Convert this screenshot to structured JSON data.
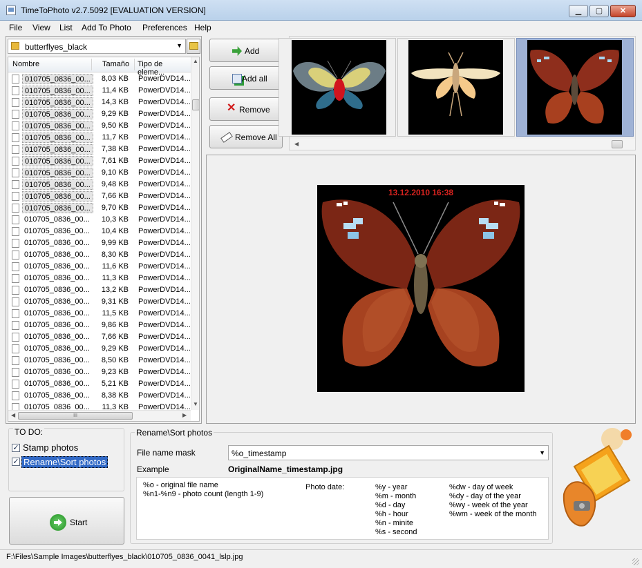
{
  "window": {
    "title": "TimeToPhoto v2.7.5092 [EVALUATION VERSION]",
    "min_label": "▁",
    "max_label": "▢",
    "close_label": "✕"
  },
  "menu": [
    "File",
    "View",
    "List",
    "Add To Photo",
    "Preferences",
    "Help"
  ],
  "folder": {
    "name": "butterflyes_black"
  },
  "file_list": {
    "columns": [
      "Nombre",
      "Tamaño",
      "Tipo de eleme..."
    ],
    "rows": [
      {
        "name": "010705_0836_00...",
        "size": "8,03 KB",
        "type": "PowerDVD14...",
        "selected": true
      },
      {
        "name": "010705_0836_00...",
        "size": "11,4 KB",
        "type": "PowerDVD14...",
        "selected": true
      },
      {
        "name": "010705_0836_00...",
        "size": "14,3 KB",
        "type": "PowerDVD14...",
        "selected": true
      },
      {
        "name": "010705_0836_00...",
        "size": "9,29 KB",
        "type": "PowerDVD14...",
        "selected": true
      },
      {
        "name": "010705_0836_00...",
        "size": "9,50 KB",
        "type": "PowerDVD14...",
        "selected": true
      },
      {
        "name": "010705_0836_00...",
        "size": "11,7 KB",
        "type": "PowerDVD14...",
        "selected": true
      },
      {
        "name": "010705_0836_00...",
        "size": "7,38 KB",
        "type": "PowerDVD14...",
        "selected": true
      },
      {
        "name": "010705_0836_00...",
        "size": "7,61 KB",
        "type": "PowerDVD14...",
        "selected": true
      },
      {
        "name": "010705_0836_00...",
        "size": "9,10 KB",
        "type": "PowerDVD14...",
        "selected": true
      },
      {
        "name": "010705_0836_00...",
        "size": "9,48 KB",
        "type": "PowerDVD14...",
        "selected": true
      },
      {
        "name": "010705_0836_00...",
        "size": "7,66 KB",
        "type": "PowerDVD14...",
        "selected": true
      },
      {
        "name": "010705_0836_00...",
        "size": "9,70 KB",
        "type": "PowerDVD14...",
        "selected": true
      },
      {
        "name": "010705_0836_00...",
        "size": "10,3 KB",
        "type": "PowerDVD14...",
        "selected": false
      },
      {
        "name": "010705_0836_00...",
        "size": "10,4 KB",
        "type": "PowerDVD14...",
        "selected": false
      },
      {
        "name": "010705_0836_00...",
        "size": "9,99 KB",
        "type": "PowerDVD14...",
        "selected": false
      },
      {
        "name": "010705_0836_00...",
        "size": "8,30 KB",
        "type": "PowerDVD14...",
        "selected": false
      },
      {
        "name": "010705_0836_00...",
        "size": "11,6 KB",
        "type": "PowerDVD14...",
        "selected": false
      },
      {
        "name": "010705_0836_00...",
        "size": "11,3 KB",
        "type": "PowerDVD14...",
        "selected": false
      },
      {
        "name": "010705_0836_00...",
        "size": "13,2 KB",
        "type": "PowerDVD14...",
        "selected": false
      },
      {
        "name": "010705_0836_00...",
        "size": "9,31 KB",
        "type": "PowerDVD14...",
        "selected": false
      },
      {
        "name": "010705_0836_00...",
        "size": "11,5 KB",
        "type": "PowerDVD14...",
        "selected": false
      },
      {
        "name": "010705_0836_00...",
        "size": "9,86 KB",
        "type": "PowerDVD14...",
        "selected": false
      },
      {
        "name": "010705_0836_00...",
        "size": "7,66 KB",
        "type": "PowerDVD14...",
        "selected": false
      },
      {
        "name": "010705_0836_00...",
        "size": "9,29 KB",
        "type": "PowerDVD14...",
        "selected": false
      },
      {
        "name": "010705_0836_00...",
        "size": "8,50 KB",
        "type": "PowerDVD14...",
        "selected": false
      },
      {
        "name": "010705_0836_00...",
        "size": "9,23 KB",
        "type": "PowerDVD14...",
        "selected": false
      },
      {
        "name": "010705_0836_00...",
        "size": "5,21 KB",
        "type": "PowerDVD14...",
        "selected": false
      },
      {
        "name": "010705_0836_00...",
        "size": "8,38 KB",
        "type": "PowerDVD14...",
        "selected": false
      },
      {
        "name": "010705_0836_00...",
        "size": "11,3 KB",
        "type": "PowerDVD14...",
        "selected": false
      }
    ],
    "hscroll_grip": "III"
  },
  "actions": {
    "add": "Add",
    "add_all": "Add all",
    "remove": "Remove",
    "remove_all": "Remove All"
  },
  "preview": {
    "timestamp": "13.12.2010 16:38"
  },
  "todo": {
    "title": "TO DO:",
    "stamp_photos": "Stamp photos",
    "stamp_checked": true,
    "rename_sort": "Rename\\Sort photos",
    "rename_checked": true
  },
  "start_button": "Start",
  "rename": {
    "title": "Rename\\Sort photos",
    "mask_label": "File name mask",
    "mask_value": "%o_timestamp",
    "example_label": "Example",
    "example_value": "OriginalName_timestamp.jpg",
    "help": {
      "col1": [
        "%o - original file name",
        "%n1-%n9 - photo count (length  1-9)"
      ],
      "photo_date_label": "Photo date:",
      "col2": [
        "%y - year",
        "%m - month",
        "%d - day",
        "%h - hour",
        "%n - minite",
        "%s - second"
      ],
      "col3": [
        "%dw - day of week",
        "%dy - day of the year",
        "%wy - week of the year",
        "%wm - week of the month"
      ]
    }
  },
  "status": {
    "path": "F:\\Files\\Sample Images\\butterflyes_black\\010705_0836_0041_lslp.jpg"
  },
  "colors": {
    "selection": "#3169c6",
    "stamp_text": "#d8231f",
    "logo_orange": "#f5a21b"
  }
}
